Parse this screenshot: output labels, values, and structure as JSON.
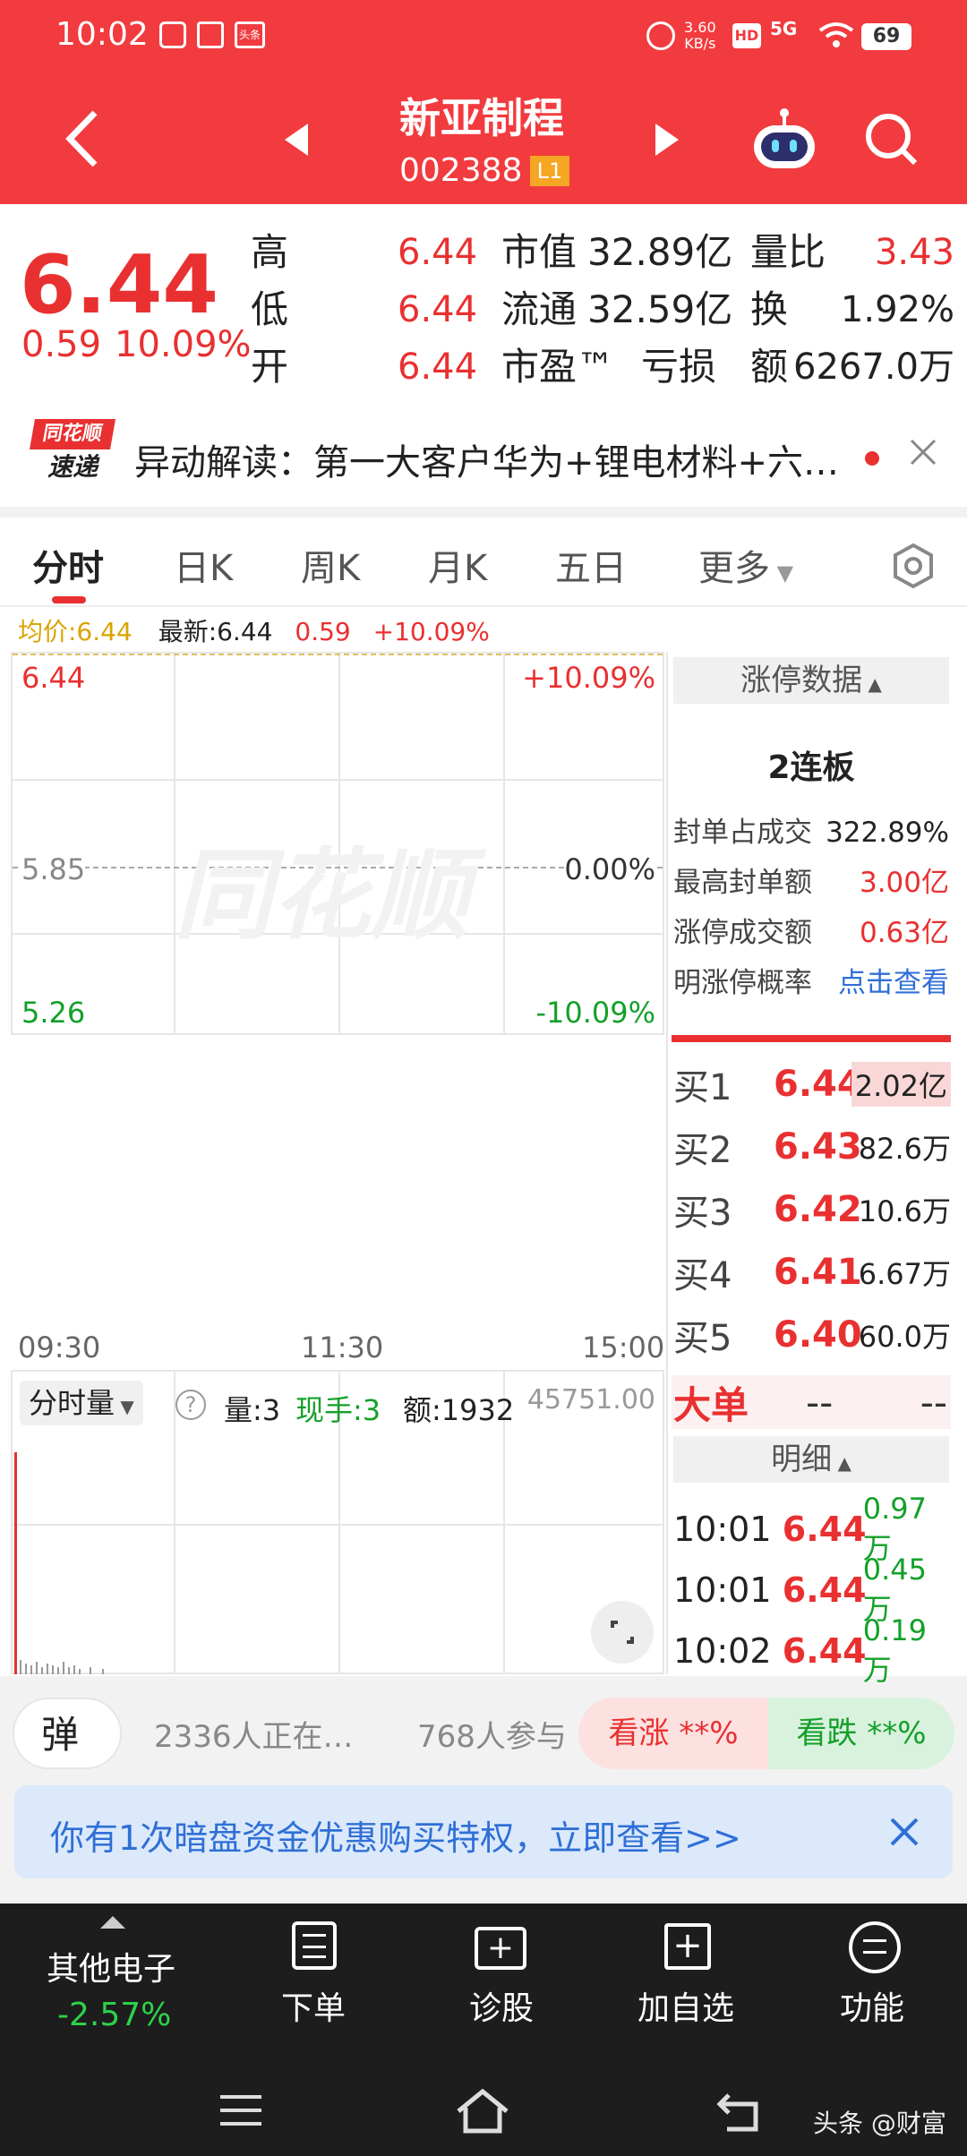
{
  "status": {
    "time": "10:02",
    "speed": "3.60\nKB/s",
    "speed_top": "3.60",
    "speed_bot": "KB/s",
    "hd": "HD",
    "net": "5G",
    "battery": "69"
  },
  "header": {
    "name": "新亚制程",
    "code": "002388",
    "level": "L1"
  },
  "quote": {
    "price": "6.44",
    "change": "0.59",
    "pct": "10.09%",
    "cols": [
      {
        "label": "高",
        "value": "6.44"
      },
      {
        "label": "低",
        "value": "6.44"
      },
      {
        "label": "开",
        "value": "6.44"
      }
    ],
    "mid": [
      {
        "label": "市值",
        "value": "32.89亿"
      },
      {
        "label": "流通",
        "value": "32.59亿"
      },
      {
        "label": "市盈™",
        "value": "亏损"
      }
    ],
    "right": [
      {
        "label": "量比",
        "value": "3.43"
      },
      {
        "label": "换",
        "value": "1.92%"
      },
      {
        "label": "额",
        "value": "6267.0万"
      }
    ]
  },
  "news": {
    "brand_top": "同花顺",
    "brand_bot": "速递",
    "text": "异动解读：第一大客户华为+锂电材料+六…"
  },
  "tabs": [
    {
      "label": "分时",
      "active": true
    },
    {
      "label": "日K"
    },
    {
      "label": "周K"
    },
    {
      "label": "月K"
    },
    {
      "label": "五日"
    },
    {
      "label": "更多"
    }
  ],
  "chart": {
    "avg": "均价:6.44",
    "latest_label": "最新:6.44",
    "latest_chg": "0.59",
    "latest_pct": "+10.09%",
    "top_price": "6.44",
    "top_pct": "+10.09%",
    "mid_price": "5.85",
    "mid_pct": "0.00%",
    "bot_price": "5.26",
    "bot_pct": "-10.09%",
    "times": [
      "09:30",
      "11:30",
      "15:00"
    ],
    "watermark": "同花顺"
  },
  "limit": {
    "header": "涨停数据",
    "title": "2连板",
    "rows": [
      {
        "label": "封单占成交",
        "value": "322.89%"
      },
      {
        "label": "最高封单额",
        "value": "3.00亿"
      },
      {
        "label": "涨停成交额",
        "value": "0.63亿"
      },
      {
        "label": "明涨停概率",
        "value": "点击查看"
      }
    ]
  },
  "bids": [
    {
      "label": "买1",
      "price": "6.44",
      "vol": "2.02亿"
    },
    {
      "label": "买2",
      "price": "6.43",
      "vol": "82.6万"
    },
    {
      "label": "买3",
      "price": "6.42",
      "vol": "10.6万"
    },
    {
      "label": "买4",
      "price": "6.41",
      "vol": "6.67万"
    },
    {
      "label": "买5",
      "price": "6.40",
      "vol": "60.0万"
    }
  ],
  "bigorder": {
    "label": "大单",
    "a": "--",
    "b": "--"
  },
  "detail": {
    "header": "明细",
    "rows": [
      {
        "time": "10:01",
        "price": "6.44",
        "vol": "0.97万"
      },
      {
        "time": "10:01",
        "price": "6.44",
        "vol": "0.45万"
      },
      {
        "time": "10:02",
        "price": "6.44",
        "vol": "0.19万"
      }
    ]
  },
  "volume": {
    "selector": "分时量",
    "qty": "量:3",
    "hand": "现手:3",
    "amt": "额:1932",
    "max": "45751.00"
  },
  "social": {
    "danmu": "弹",
    "watching": "2336人正在…",
    "participants": "768人参与",
    "up": "看涨 **%",
    "down": "看跌 **%"
  },
  "promo": {
    "text": "你有1次暗盘资金优惠购买特权，立即查看>>"
  },
  "bottombar": {
    "sector": "其他电子",
    "sector_pct": "-2.57%",
    "items": [
      "下单",
      "诊股",
      "加自选",
      "功能"
    ]
  },
  "watermark": "头条 @财富"
}
